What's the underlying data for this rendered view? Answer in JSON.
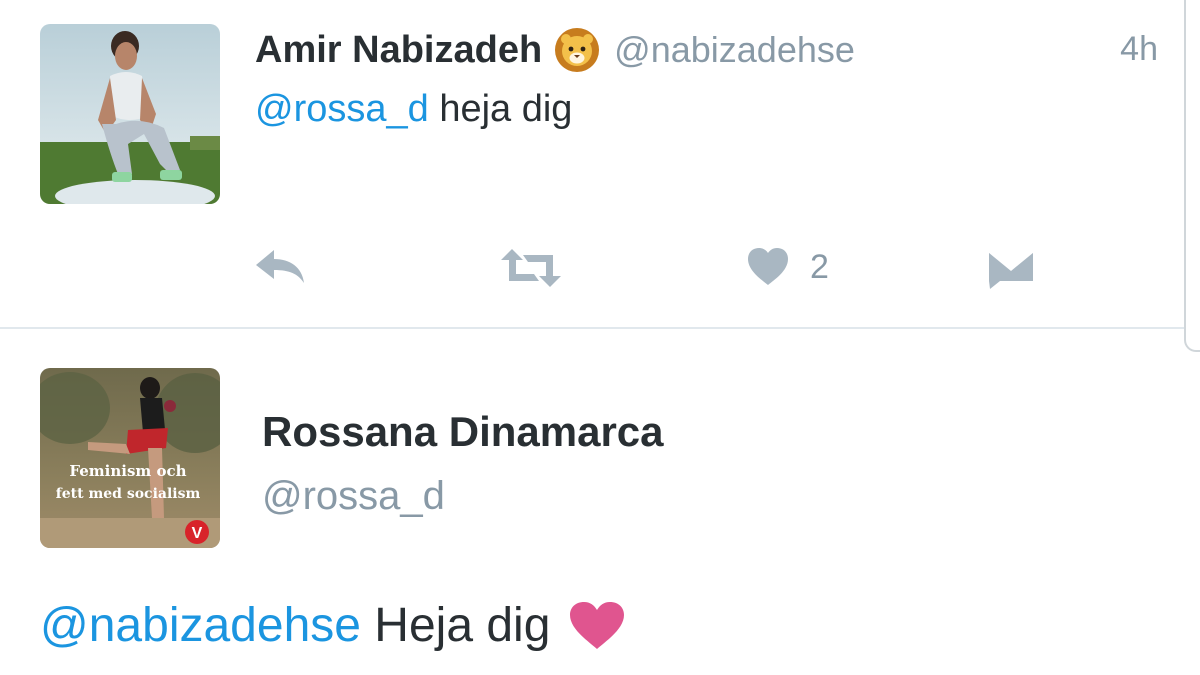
{
  "tweet": {
    "author_name": "Amir Nabizadeh",
    "author_emoji": "lion-face-emoji",
    "author_handle": "@nabizadehse",
    "time": "4h",
    "reply_mention": "@rossa_d",
    "reply_text": " heja dig",
    "actions": {
      "reply_icon": "reply-icon",
      "retweet_icon": "retweet-icon",
      "like_icon": "heart-icon",
      "like_count": "2",
      "dm_icon": "envelope-icon"
    }
  },
  "quoted": {
    "author_name": "Rossana Dinamarca",
    "author_handle": "@rossa_d",
    "avatar_caption_line1": "Feminism och",
    "avatar_caption_line2": "fett med socialism",
    "avatar_badge": "V",
    "text_mention": "@nabizadehse",
    "text": " Heja dig",
    "emoji": "red-heart-emoji"
  },
  "colors": {
    "link": "#1b95e0",
    "muted": "#8899a6",
    "text": "#292f33",
    "heart_emoji": "#e0558f",
    "badge": "#d8232a"
  }
}
